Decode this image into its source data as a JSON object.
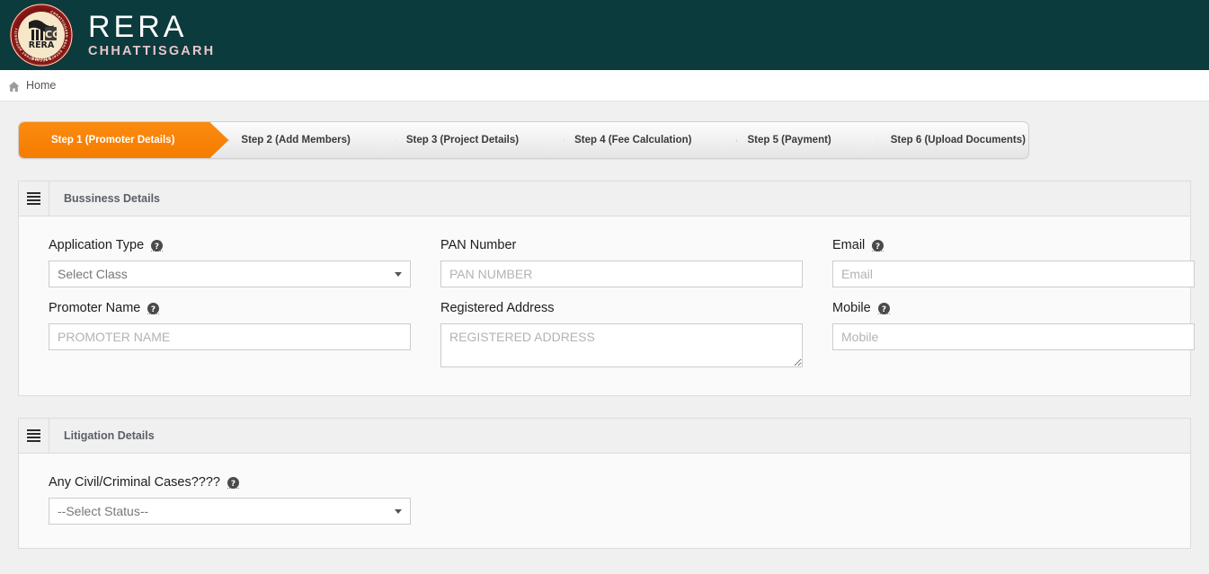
{
  "header": {
    "brand_main": "RERA",
    "brand_sub": "CHHATTISGARH",
    "logo_icon": "cg-rera-emblem-icon",
    "logo_text_cg": "CG",
    "logo_text_rera": "RERA",
    "logo_text_city": "RAIPUR",
    "logo_ring_text": "CHHATTISGARH REAL ESTATE REGULATORY AUTHORITY",
    "bg_color": "#0b3b3c"
  },
  "breadcrumb": {
    "home_icon": "home-icon",
    "home_label": "Home"
  },
  "wizard": {
    "active_color": "#f57c00",
    "steps": [
      {
        "label": "Step 1 (Promoter Details)",
        "active": true
      },
      {
        "label": "Step 2 (Add Members)",
        "active": false
      },
      {
        "label": "Step 3 (Project Details)",
        "active": false
      },
      {
        "label": "Step 4 (Fee Calculation)",
        "active": false
      },
      {
        "label": "Step 5 (Payment)",
        "active": false
      },
      {
        "label": "Step 6 (Upload Documents)",
        "active": false
      }
    ]
  },
  "business_panel": {
    "grip_icon": "hamburger-grip-icon",
    "title": "Bussiness Details",
    "fields": {
      "application_type": {
        "label": "Application Type",
        "help_icon": "question-circle-icon",
        "selected": "Select Class",
        "options": [
          "Select Class"
        ]
      },
      "pan_number": {
        "label": "PAN Number",
        "value": "",
        "placeholder": "PAN NUMBER"
      },
      "email": {
        "label": "Email",
        "help_icon": "question-circle-icon",
        "value": "",
        "placeholder": "Email"
      },
      "promoter_name": {
        "label": "Promoter Name",
        "help_icon": "question-circle-icon",
        "value": "",
        "placeholder": "PROMOTER NAME"
      },
      "registered_address": {
        "label": "Registered Address",
        "value": "",
        "placeholder": "REGISTERED ADDRESS"
      },
      "mobile": {
        "label": "Mobile",
        "help_icon": "question-circle-icon",
        "value": "",
        "placeholder": "Mobile"
      }
    }
  },
  "litigation_panel": {
    "grip_icon": "hamburger-grip-icon",
    "title": "Litigation Details",
    "fields": {
      "civil_criminal_cases": {
        "label": "Any Civil/Criminal Cases????",
        "help_icon": "question-circle-icon",
        "selected": "--Select Status--",
        "options": [
          "--Select Status--"
        ]
      }
    }
  }
}
